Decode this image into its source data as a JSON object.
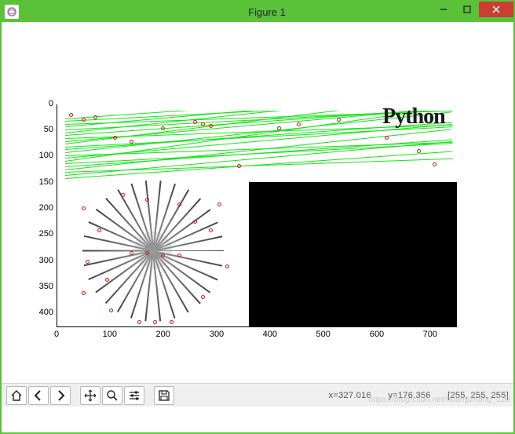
{
  "window": {
    "title": "Figure 1"
  },
  "axes": {
    "y_ticks": [
      "0",
      "50",
      "100",
      "150",
      "200",
      "250",
      "300",
      "350",
      "400"
    ],
    "x_ticks": [
      "0",
      "100",
      "200",
      "300",
      "400",
      "500",
      "600",
      "700"
    ]
  },
  "overlay_text": {
    "python": "Python"
  },
  "toolbar": {
    "home": "Home",
    "back": "Back",
    "forward": "Forward",
    "pan": "Pan",
    "zoom": "Zoom",
    "configure": "Configure subplots",
    "save": "Save"
  },
  "status": {
    "x_label": "x=327.016",
    "y_label": "y=176.356",
    "pixel": "[255, 255, 255]"
  },
  "chart_data": {
    "type": "image",
    "title": "Figure 1",
    "xlim": [
      0,
      750
    ],
    "ylim": [
      420,
      0
    ],
    "description": "Feature matching visualization: top region shows two Python logo images connected by many green match lines with red keypoints; bottom-left shows radial burst pattern with red keypoints; bottom-right quadrant is solid black.",
    "cursor": {
      "x": 327.016,
      "y": 176.356,
      "rgb": [
        255,
        255,
        255
      ]
    }
  },
  "watermark": "https://blog.csdn.net/huangzhang_123"
}
